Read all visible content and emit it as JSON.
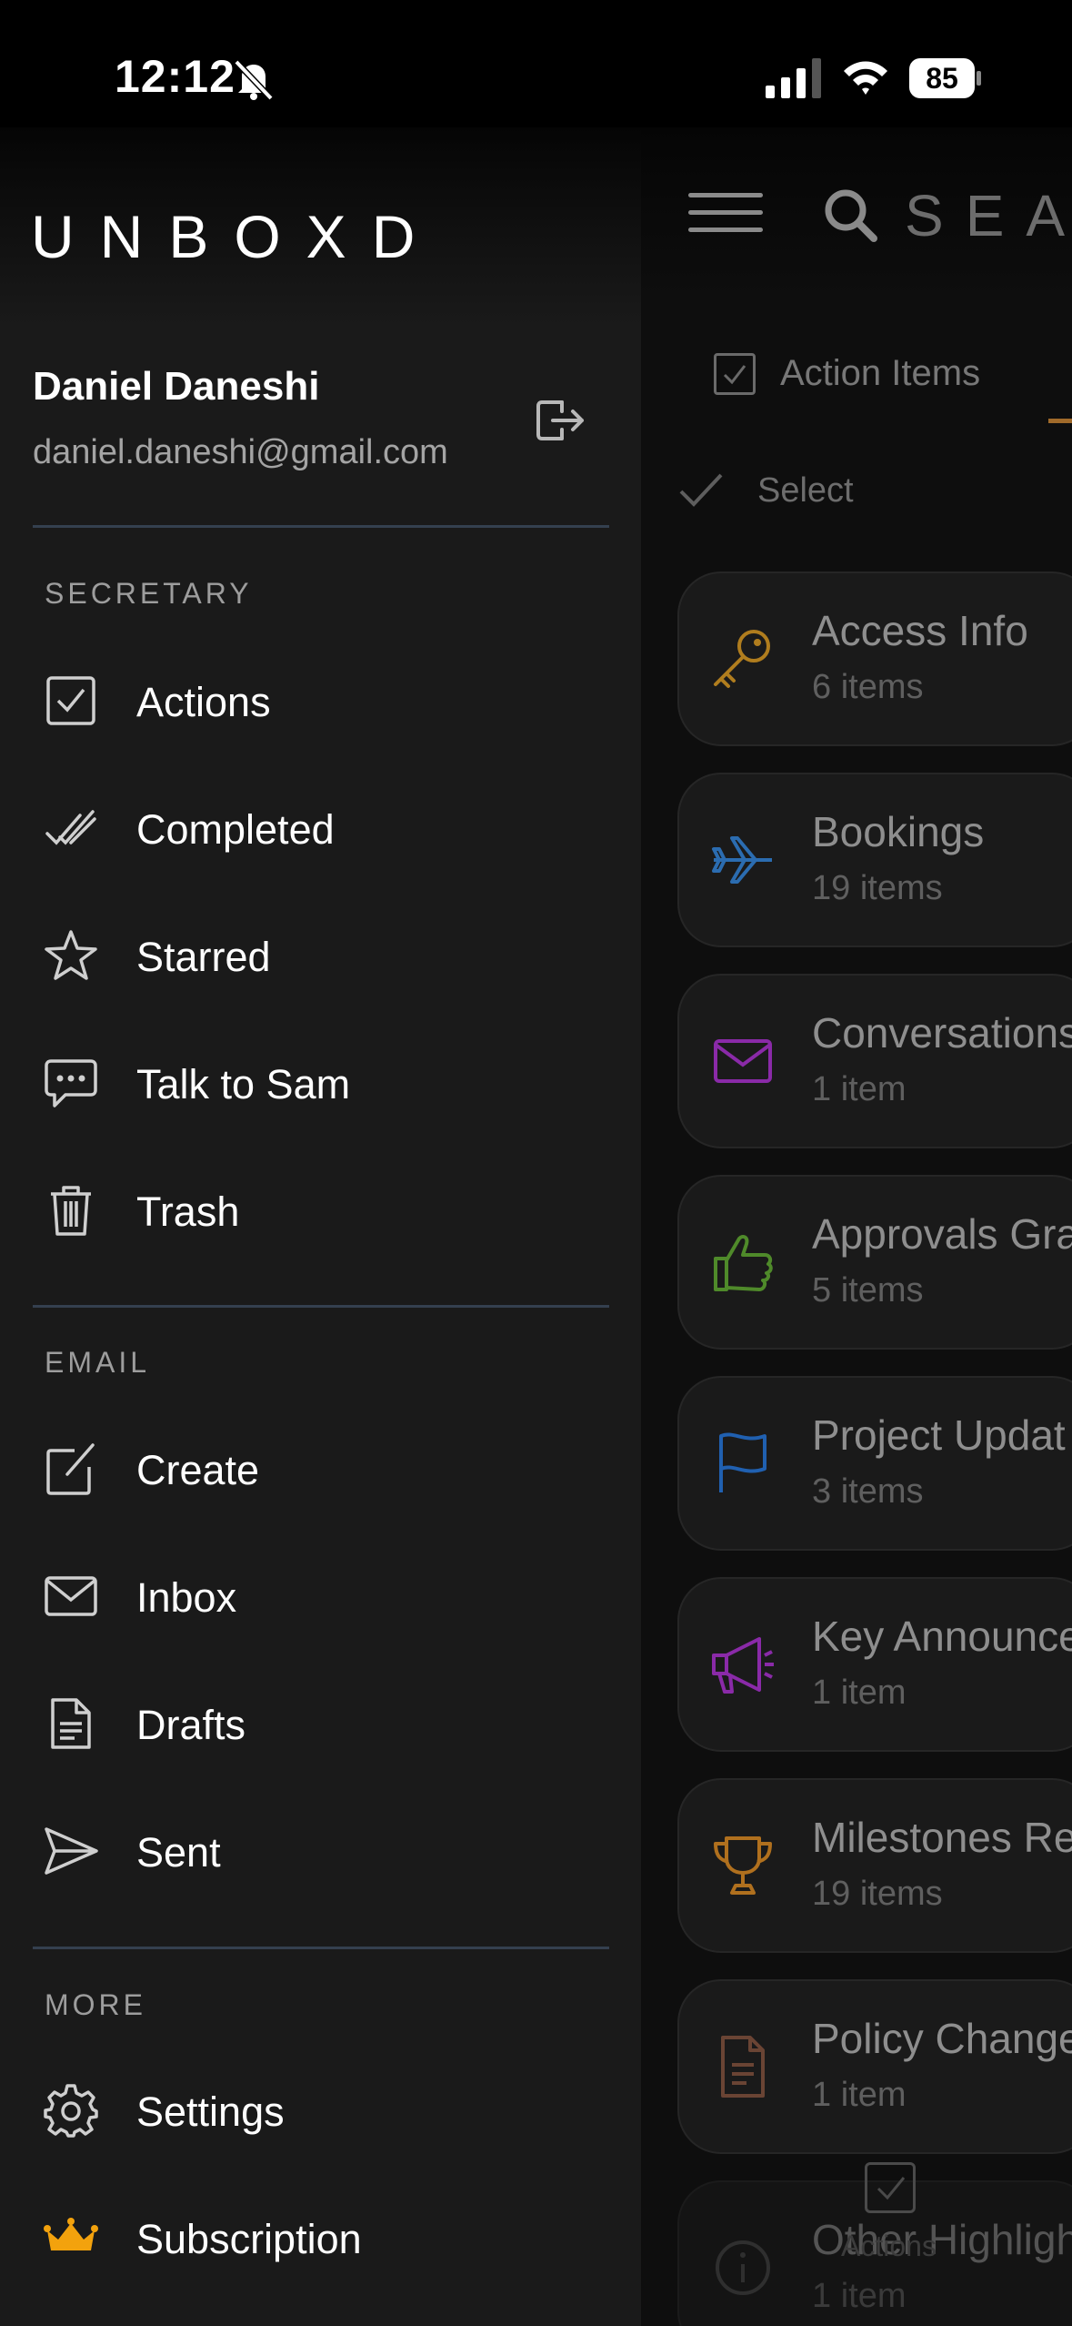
{
  "status_bar": {
    "time": "12:12",
    "battery": "85"
  },
  "drawer": {
    "logo": "UNBOXD",
    "user": {
      "name": "Daniel Daneshi",
      "email": "daniel.daneshi@gmail.com"
    },
    "sections": {
      "secretary": {
        "label": "SECRETARY",
        "items": [
          {
            "label": "Actions",
            "icon": "checkbox-icon"
          },
          {
            "label": "Completed",
            "icon": "double-check-icon"
          },
          {
            "label": "Starred",
            "icon": "star-icon"
          },
          {
            "label": "Talk to Sam",
            "icon": "chat-bubble-icon"
          },
          {
            "label": "Trash",
            "icon": "trash-icon"
          }
        ]
      },
      "email": {
        "label": "EMAIL",
        "items": [
          {
            "label": "Create",
            "icon": "compose-icon"
          },
          {
            "label": "Inbox",
            "icon": "envelope-icon"
          },
          {
            "label": "Drafts",
            "icon": "document-icon"
          },
          {
            "label": "Sent",
            "icon": "send-icon"
          }
        ]
      },
      "more": {
        "label": "MORE",
        "items": [
          {
            "label": "Settings",
            "icon": "gear-icon"
          },
          {
            "label": "Subscription",
            "icon": "crown-icon"
          }
        ]
      }
    }
  },
  "main": {
    "search_text": "SEA",
    "tab": {
      "label": "Action Items"
    },
    "select_label": "Select",
    "cards": [
      {
        "title": "Access Info",
        "count": "6 items",
        "icon": "key-icon",
        "color": "#b07d1e"
      },
      {
        "title": "Bookings",
        "count": "19 items",
        "icon": "airplane-icon",
        "color": "#2b6cb0"
      },
      {
        "title": "Conversations",
        "count": "1 item",
        "icon": "envelope-icon",
        "color": "#8a2aa8"
      },
      {
        "title": "Approvals Gra",
        "count": "5 items",
        "icon": "thumbs-up-icon",
        "color": "#4f8a2a"
      },
      {
        "title": "Project Updat",
        "count": "3 items",
        "icon": "flag-icon",
        "color": "#2060b0"
      },
      {
        "title": "Key Announce",
        "count": "1 item",
        "icon": "megaphone-icon",
        "color": "#8a2aa8"
      },
      {
        "title": "Milestones Re",
        "count": "19 items",
        "icon": "trophy-icon",
        "color": "#b0701e"
      },
      {
        "title": "Policy Change",
        "count": "1 item",
        "icon": "document-icon",
        "color": "#6a4434"
      },
      {
        "title": "Other Highligh",
        "count": "1 item",
        "icon": "info-icon",
        "color": "#3a3a3a"
      }
    ],
    "bottom_nav": {
      "label": "Actions"
    }
  }
}
